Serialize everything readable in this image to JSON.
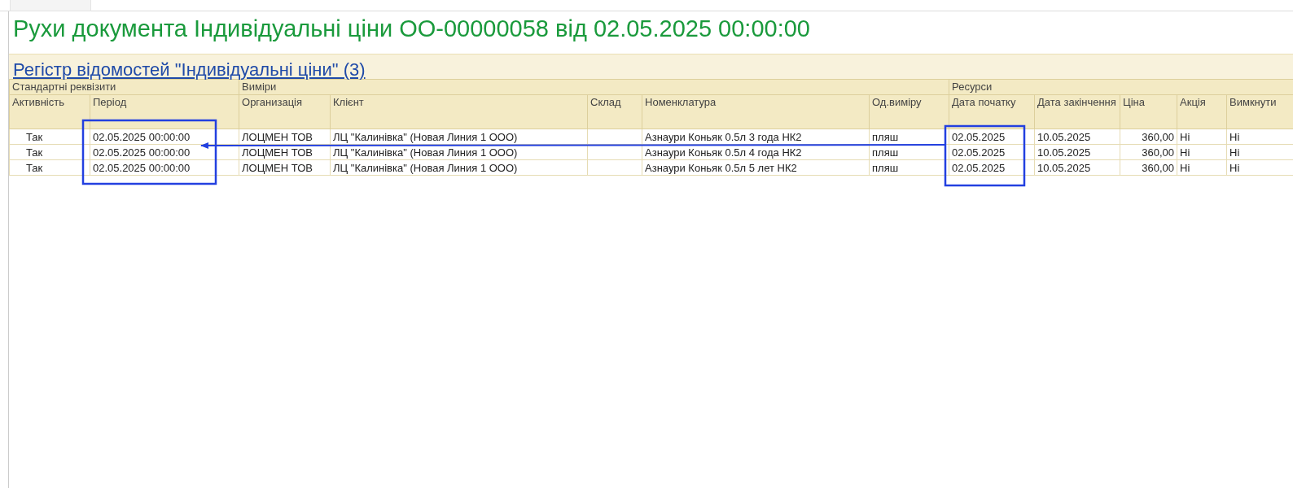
{
  "title": "Рухи документа Індивідуальні ціни ОО-00000058 від 02.05.2025 00:00:00",
  "register": {
    "title": "Регістр відомостей \"Індивідуальні ціни\" (3)"
  },
  "column_groups": [
    {
      "label": "Стандартні реквізити",
      "columns": [
        {
          "label": "Активність",
          "kind": "flag"
        },
        {
          "label": "Період",
          "kind": "text"
        }
      ]
    },
    {
      "label": "Виміри",
      "columns": [
        {
          "label": "Организація",
          "kind": "text"
        },
        {
          "label": "Клієнт",
          "kind": "text"
        },
        {
          "label": "Склад",
          "kind": "text"
        },
        {
          "label": "Номенклатура",
          "kind": "text"
        },
        {
          "label": "Од.виміру",
          "kind": "text"
        }
      ]
    },
    {
      "label": "Ресурси",
      "columns": [
        {
          "label": "Дата початку",
          "kind": "text"
        },
        {
          "label": "Дата закінчення",
          "kind": "text"
        },
        {
          "label": "Ціна",
          "kind": "number"
        },
        {
          "label": "Акція",
          "kind": "text"
        },
        {
          "label": "Вимкнути",
          "kind": "text"
        }
      ]
    }
  ],
  "rows": [
    [
      "Так",
      "02.05.2025 00:00:00",
      "ЛОЦМЕН ТОВ",
      "ЛЦ \"Калинівка\" (Новая Линия 1 ООО)",
      null,
      "Азнаури Коньяк 0.5л 3 года НК2",
      "пляш",
      "02.05.2025",
      "10.05.2025",
      "360,00",
      "Ні",
      "Ні"
    ],
    [
      "Так",
      "02.05.2025 00:00:00",
      "ЛОЦМЕН ТОВ",
      "ЛЦ \"Калинівка\" (Новая Линия 1 ООО)",
      null,
      "Азнаури Коньяк 0.5л 4 года НК2",
      "пляш",
      "02.05.2025",
      "10.05.2025",
      "360,00",
      "Ні",
      "Ні"
    ],
    [
      "Так",
      "02.05.2025 00:00:00",
      "ЛОЦМЕН ТОВ",
      "ЛЦ \"Калинівка\" (Новая Линия 1 ООО)",
      null,
      "Азнаури Коньяк 0.5л 5 лет НК2",
      "пляш",
      "02.05.2025",
      "10.05.2025",
      "360,00",
      "Ні",
      "Ні"
    ]
  ]
}
